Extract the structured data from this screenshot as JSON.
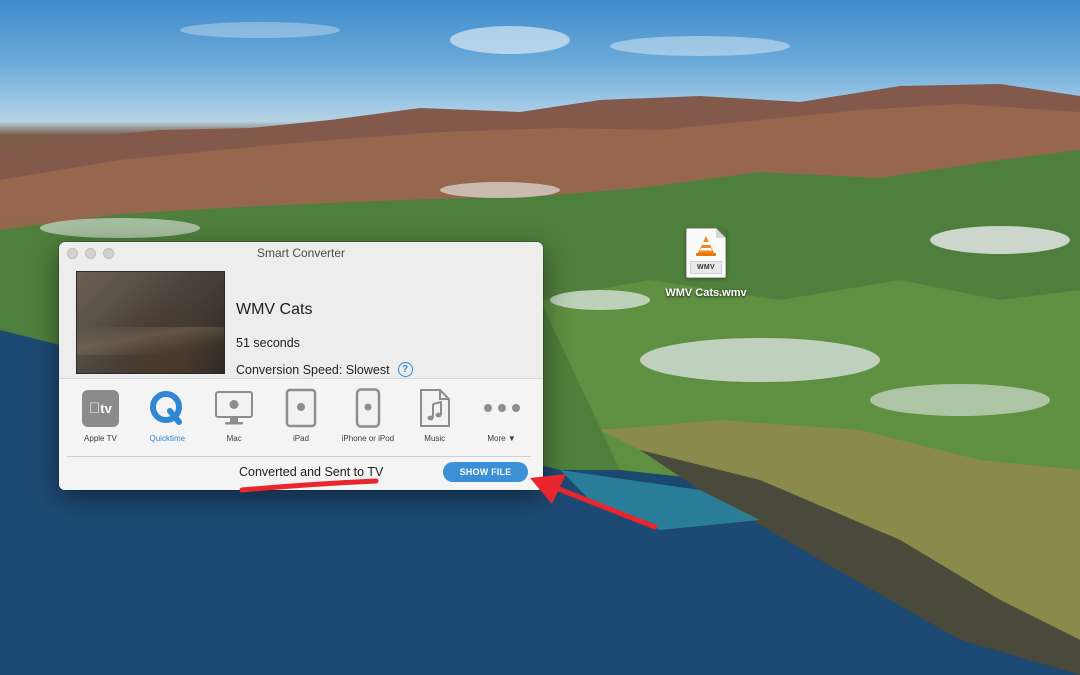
{
  "desktop": {
    "file_name": "WMV Cats.wmv",
    "file_badge": "WMV"
  },
  "window": {
    "title": "Smart Converter",
    "media": {
      "title": "WMV Cats",
      "duration": "51 seconds",
      "speed": "Conversion Speed: Slowest",
      "help_glyph": "?"
    },
    "devices": [
      {
        "label": "Apple TV",
        "icon": "apple-tv-icon"
      },
      {
        "label": "Quicktime",
        "icon": "quicktime-icon",
        "selected": true
      },
      {
        "label": "Mac",
        "icon": "mac-icon"
      },
      {
        "label": "iPad",
        "icon": "ipad-icon"
      },
      {
        "label": "iPhone or iPod",
        "icon": "iphone-icon"
      },
      {
        "label": "Music",
        "icon": "music-icon"
      },
      {
        "label": "More ▼",
        "icon": "more-icon"
      }
    ],
    "apple_tv_mark": "tv",
    "status": "Converted and Sent to TV",
    "show_file": "SHOW FILE"
  },
  "colors": {
    "accent": "#3b8fd6",
    "annotation": "#e8262c"
  }
}
